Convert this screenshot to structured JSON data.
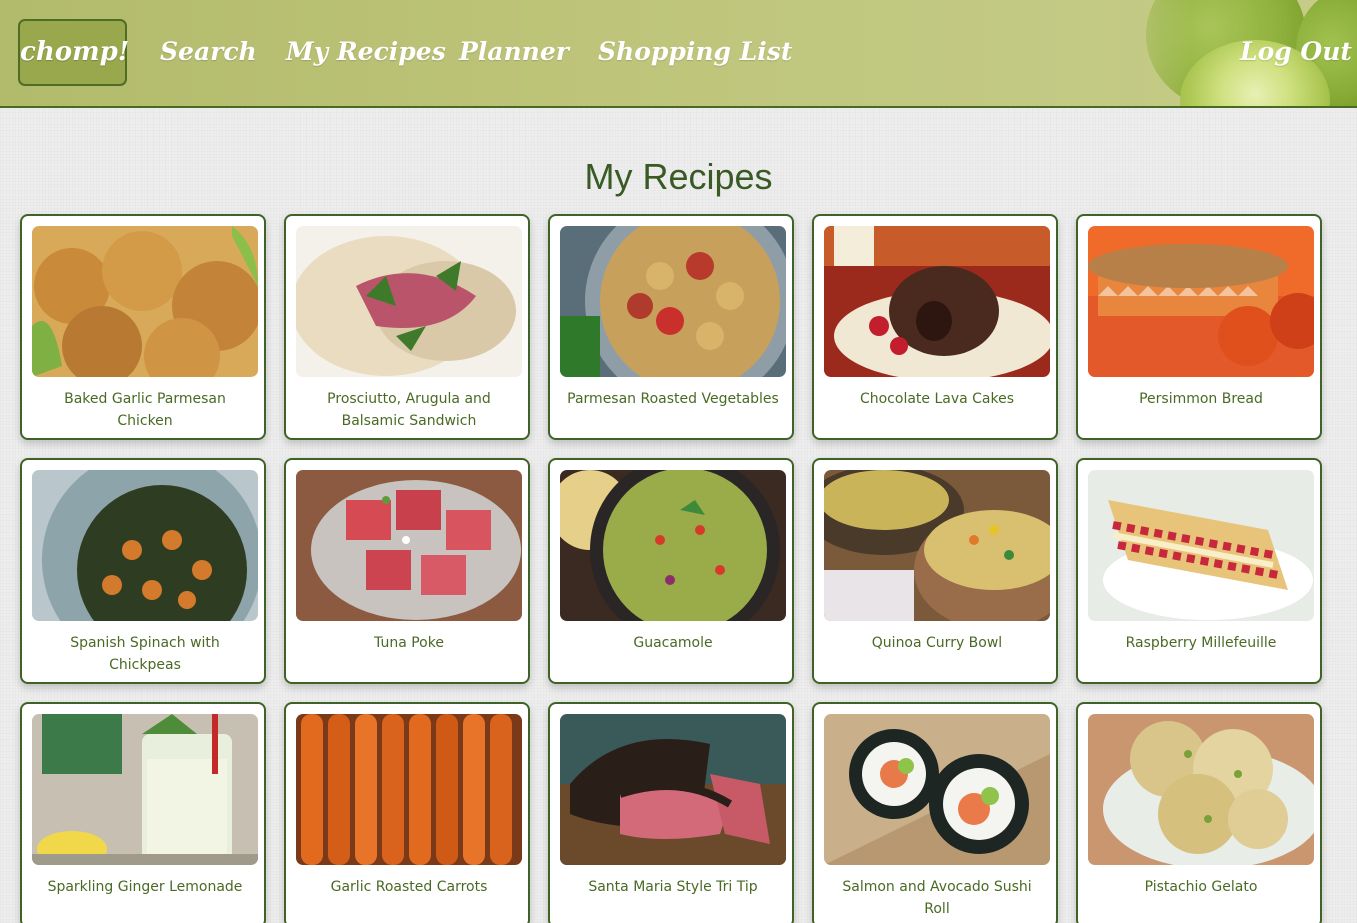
{
  "header": {
    "logo": "chomp!",
    "nav": [
      {
        "label": "Search"
      },
      {
        "label": "My Recipes"
      },
      {
        "label": "Planner"
      },
      {
        "label": "Shopping List"
      }
    ],
    "logout": "Log Out"
  },
  "page": {
    "title": "My Recipes"
  },
  "recipes": [
    {
      "title": "Baked Garlic Parmesan Chicken",
      "image": "fried-chicken-photo"
    },
    {
      "title": "Prosciutto, Arugula and Balsamic Sandwich",
      "image": "sandwich-photo"
    },
    {
      "title": "Parmesan Roasted Vegetables",
      "image": "roasted-vegetables-photo"
    },
    {
      "title": "Chocolate Lava Cakes",
      "image": "lava-cake-photo"
    },
    {
      "title": "Persimmon Bread",
      "image": "bread-photo"
    },
    {
      "title": "Spanish Spinach with Chickpeas",
      "image": "spinach-chickpeas-photo"
    },
    {
      "title": "Tuna Poke",
      "image": "tuna-poke-photo"
    },
    {
      "title": "Guacamole",
      "image": "guacamole-photo"
    },
    {
      "title": "Quinoa Curry Bowl",
      "image": "quinoa-bowl-photo"
    },
    {
      "title": "Raspberry Millefeuille",
      "image": "millefeuille-photo"
    },
    {
      "title": "Sparkling Ginger Lemonade",
      "image": "lemonade-photo"
    },
    {
      "title": "Garlic Roasted Carrots",
      "image": "carrots-photo"
    },
    {
      "title": "Santa Maria Style Tri Tip",
      "image": "tri-tip-photo"
    },
    {
      "title": "Salmon and Avocado Sushi Roll",
      "image": "sushi-photo"
    },
    {
      "title": "Pistachio Gelato",
      "image": "gelato-photo"
    }
  ],
  "colors": {
    "header": "#bec57a",
    "accent": "#3f6326",
    "text": "#4a6a24",
    "background": "#eeeeee"
  }
}
